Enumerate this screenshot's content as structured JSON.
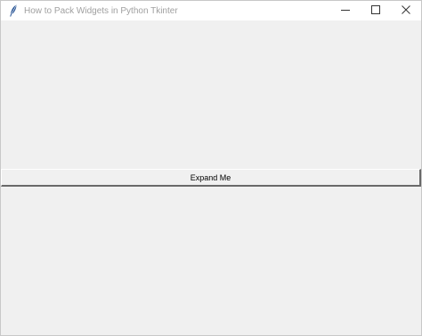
{
  "window": {
    "title": "How to Pack Widgets in Python Tkinter",
    "icons": {
      "app": "feather-icon",
      "minimize": "minimize-icon",
      "maximize": "maximize-icon",
      "close": "close-icon"
    }
  },
  "main": {
    "button_label": "Expand Me"
  },
  "colors": {
    "client_bg": "#f0f0f0",
    "titlebar_bg": "#ffffff",
    "title_text": "#a0a0a0"
  }
}
